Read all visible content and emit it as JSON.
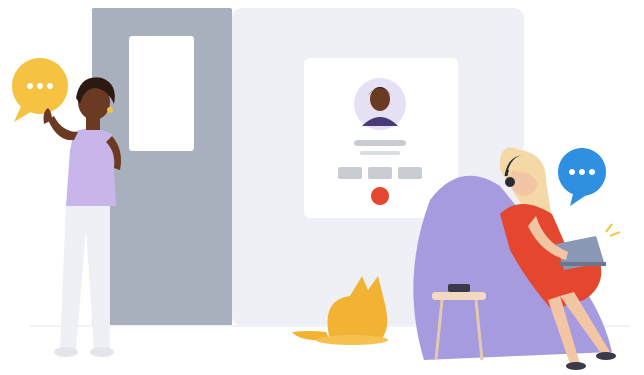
{
  "illustration": {
    "speech_bubble_left": {
      "glyph": "...",
      "color": "#F5C242"
    },
    "speech_bubble_right": {
      "glyph": "...",
      "color": "#2F8FE0"
    }
  },
  "call_card": {
    "end_call_color": "#E5472E",
    "control_color": "#C9CCD1"
  },
  "colors": {
    "panel": "#EEF0F5",
    "door": "#A7B0BC",
    "window": "#FFFFFF",
    "chair": "#A79BE0",
    "cat": "#F2B233",
    "dress": "#E5472E",
    "top": "#C8B6EA",
    "pants": "#EEF0F5",
    "skin_dark": "#6B3A22",
    "skin_light": "#F2C6A4",
    "hair_blonde": "#F4D8A6"
  }
}
